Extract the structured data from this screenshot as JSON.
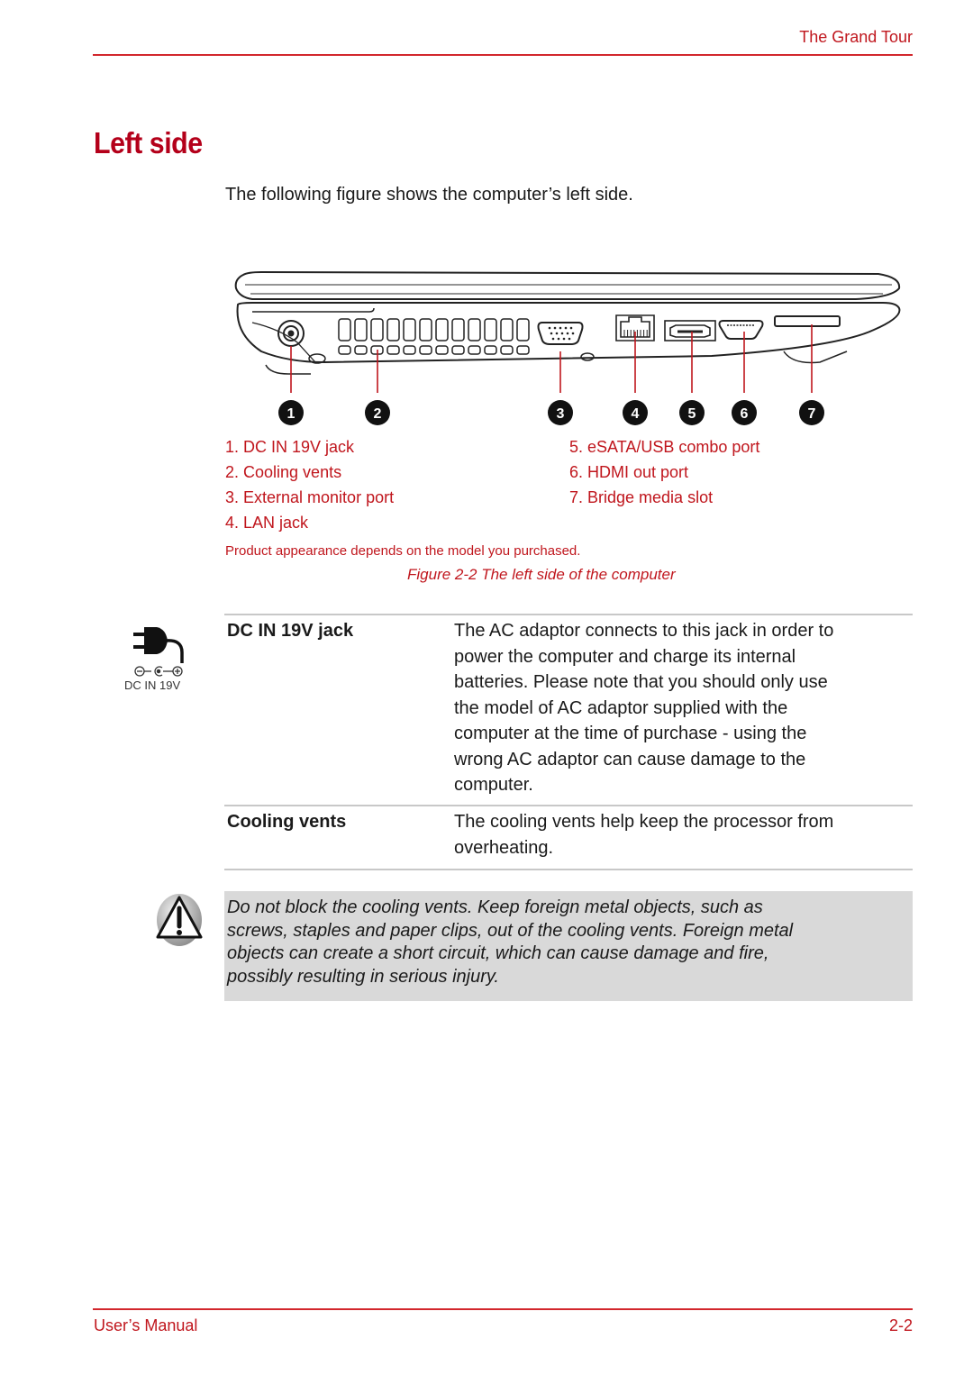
{
  "header": {
    "section_title": "The Grand Tour"
  },
  "page": {
    "title": "Left side",
    "intro": "The following figure shows the computer’s left side."
  },
  "figure": {
    "callout_numbers": [
      "1",
      "2",
      "3",
      "4",
      "5",
      "6",
      "7"
    ],
    "legend_left": [
      "1. DC IN 19V jack",
      "2. Cooling vents",
      "3. External monitor port",
      "4. LAN jack"
    ],
    "legend_right": [
      "5. eSATA/USB combo port",
      "6. HDMI out port",
      "7. Bridge media slot"
    ],
    "note": "Product appearance depends on the model you purchased.",
    "caption": "Figure 2-2 The left side of the computer"
  },
  "definitions": [
    {
      "term": "DC IN 19V jack",
      "icon": "dc-power-plug-icon",
      "icon_label": "DC IN 19V",
      "description_lines": [
        "The AC adaptor connects to this jack in order to",
        "power the computer and charge its internal",
        "batteries. Please note that you should only use",
        "the model of AC adaptor supplied with the",
        "computer at the time of purchase - using the",
        "wrong AC adaptor can cause damage to the",
        "computer."
      ]
    },
    {
      "term": "Cooling vents",
      "description_lines": [
        "The cooling vents help keep the processor from",
        "overheating."
      ]
    }
  ],
  "warning": {
    "icon": "warning-triangle-icon",
    "lines": [
      "Do not block the cooling vents. Keep foreign metal objects, such as",
      "screws, staples and paper clips, out of the cooling vents. Foreign metal",
      "objects can create a short circuit, which can cause damage and fire,",
      "possibly resulting in serious injury."
    ]
  },
  "footer": {
    "left": "User’s Manual",
    "right": "2-2"
  },
  "colors": {
    "accent": "#c0161d",
    "title": "#b4001a",
    "warning_bg": "#d9d9d9",
    "rule": "#c8c8c8"
  }
}
